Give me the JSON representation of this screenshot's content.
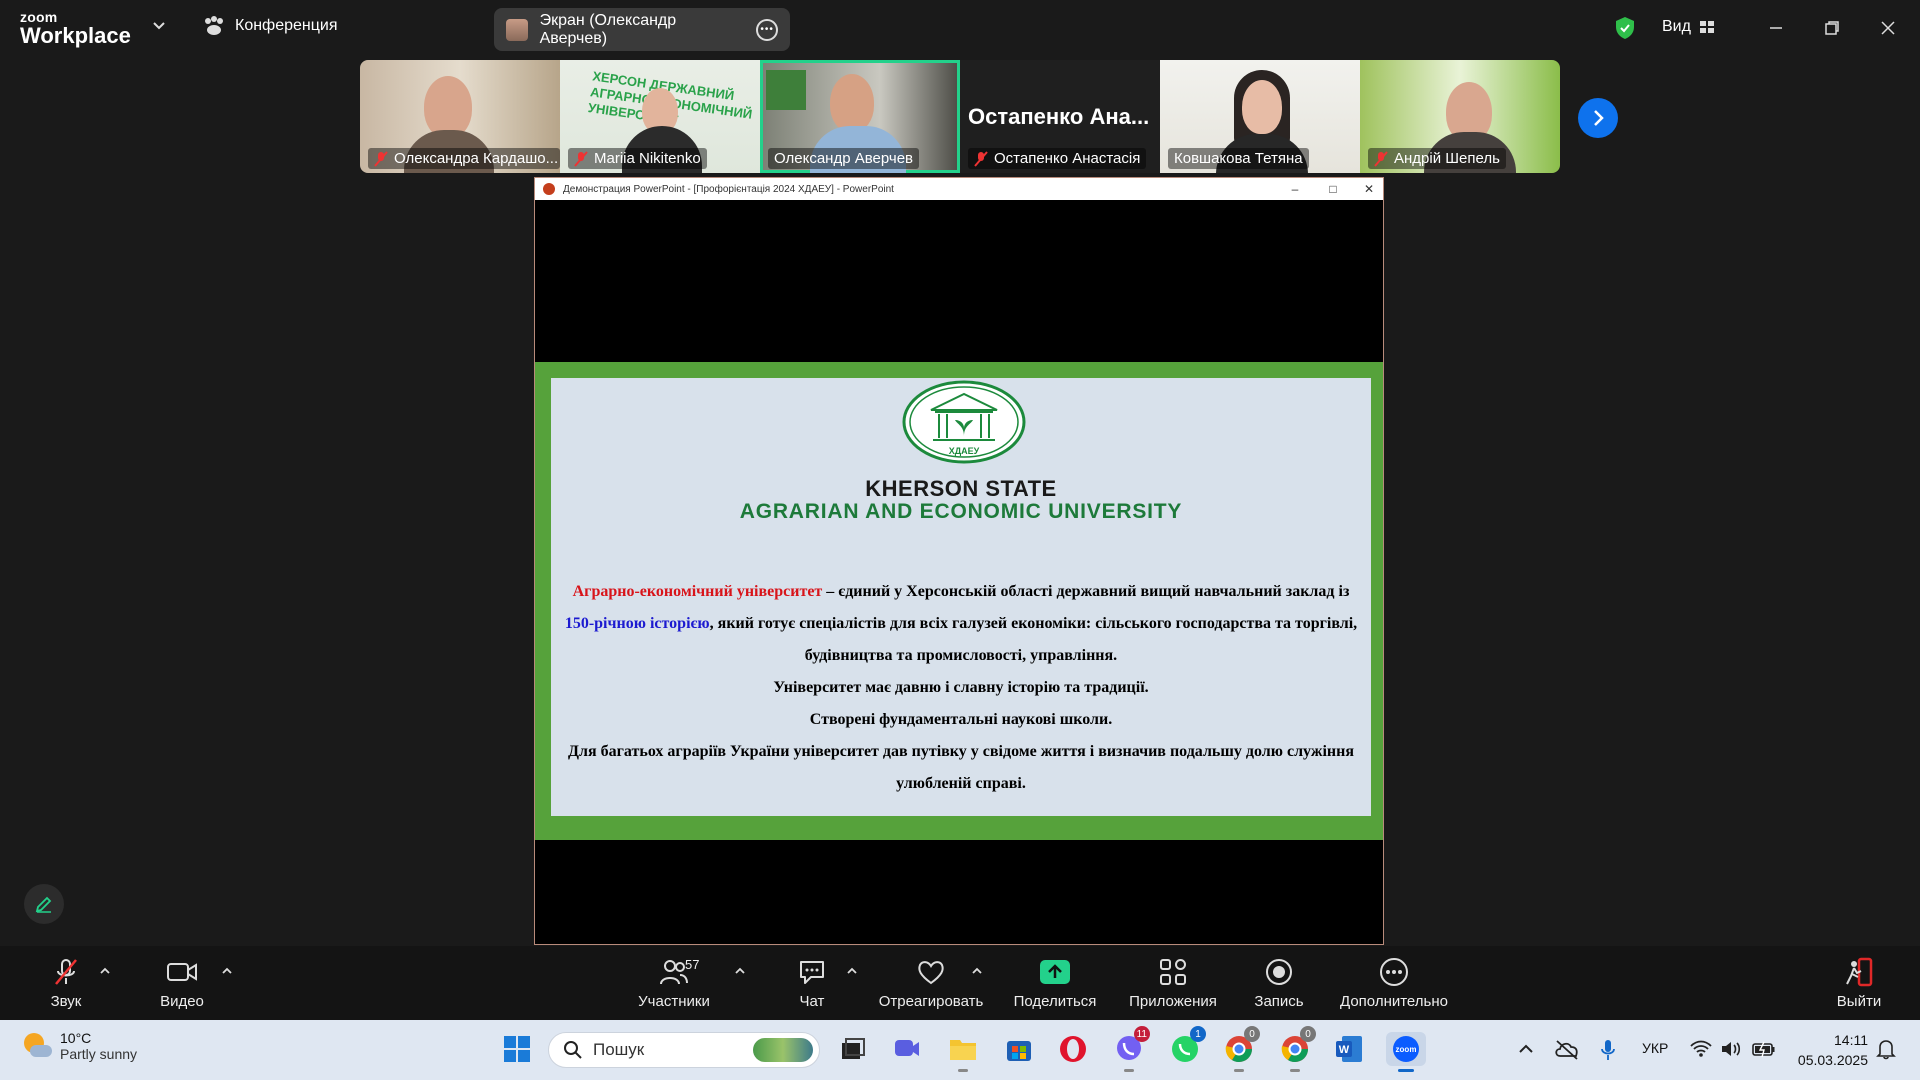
{
  "app": {
    "brand_top": "zoom",
    "brand_bottom": "Workplace",
    "conference_label": "Конференция",
    "screen_share_label": "Экран (Олександр Аверчев)",
    "view_label": "Вид"
  },
  "participants": [
    {
      "name": "Олександра Кардашо...",
      "muted": true
    },
    {
      "name": "Mariia Nikitenko",
      "muted": true
    },
    {
      "name": "Олександр Аверчев",
      "muted": false,
      "active": true
    },
    {
      "name": "Остапенко Анастасія",
      "muted": true,
      "display_name": "Остапенко  Ана..."
    },
    {
      "name": "Ковшакова Тетяна",
      "muted": false
    },
    {
      "name": "Андрій Шепель",
      "muted": true
    }
  ],
  "powerpoint": {
    "title": "Демонстрация PowerPoint - [Профорієнтація 2024 ХДАЕУ] - PowerPoint",
    "logo_text": "ХДАЕУ",
    "slide_title1": "KHERSON STATE",
    "slide_title2": "AGRARIAN AND ECONOMIC UNIVERSITY",
    "p1_red": "Аграрно-економічний університет",
    "p1_a": " – єдиний у Херсонській області державний вищий навчальний заклад із ",
    "p1_blue": "150-річною історією",
    "p1_b": ", який готує спеціалістів для всіх галузей економіки: сільського господарства та торгівлі, будівництва та промисловості, управління.",
    "p2": "Університет має давню і славну історію та традиції.",
    "p3": "Створені фундаментальні наукові школи.",
    "p4": "Для багатьох аграріїв України університет дав путівку у свідоме життя і визначив подальшу долю служіння улюбленій справі."
  },
  "toolbar": {
    "audio": "Звук",
    "video": "Видео",
    "participants": "Участники",
    "participants_count": "57",
    "chat": "Чат",
    "react": "Отреагировать",
    "share": "Поделиться",
    "apps": "Приложения",
    "record": "Запись",
    "more": "Дополнительно",
    "leave": "Выйти"
  },
  "taskbar": {
    "temp": "10°C",
    "weather": "Partly sunny",
    "search": "Пошук",
    "viber_badge": "11",
    "whatsapp_badge": "1",
    "chrome1_badge": "0",
    "chrome2_badge": "0",
    "lang": "УКР",
    "time": "14:11",
    "date": "05.03.2025"
  },
  "colors": {
    "accent": "#0e72ed",
    "active_speaker": "#23d18b",
    "slide_green": "#56a23b",
    "share_green": "#23d18b",
    "leave_red": "#e02828"
  }
}
